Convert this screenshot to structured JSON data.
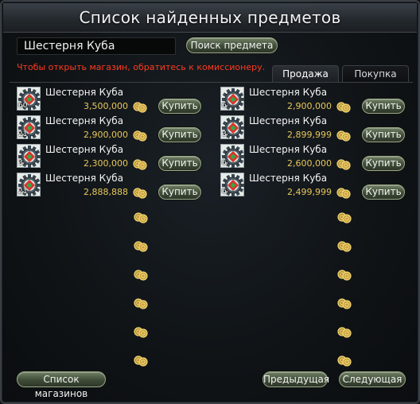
{
  "title": "Список найденных предметов",
  "search": {
    "value": "Шестерня Куба",
    "button": "Поиск предмета"
  },
  "warning": "Чтобы открыть магазин, обратитесь к комиссионеру.",
  "tabs": {
    "sale": "Продажа",
    "buy": "Покупка"
  },
  "buy_label": "Купить",
  "items_left": [
    {
      "name": "Шестерня Куба",
      "price": "3,500,000",
      "qty": "60"
    },
    {
      "name": "Шестерня Куба",
      "price": "2,900,000",
      "qty": "21"
    },
    {
      "name": "Шестерня Куба",
      "price": "2,300,000",
      "qty": "3"
    },
    {
      "name": "Шестерня Куба",
      "price": "2,888,888",
      "qty": "21"
    }
  ],
  "items_right": [
    {
      "name": "Шестерня Куба",
      "price": "2,900,000",
      "qty": "6"
    },
    {
      "name": "Шестерня Куба",
      "price": "2,899,999",
      "qty": "3"
    },
    {
      "name": "Шестерня Куба",
      "price": "2,600,000",
      "qty": "6"
    },
    {
      "name": "Шестерня Куба",
      "price": "2,499,999",
      "qty": "6"
    }
  ],
  "footer": {
    "shops": "Список магазинов",
    "prev": "Предыдущая",
    "next": "Следующая"
  },
  "colors": {
    "price": "#e6c75a",
    "warning": "#ff3a1e",
    "button": "#4a5840"
  },
  "icons": {
    "currency": "gold-coins-icon",
    "item": "gear-cube-icon"
  }
}
